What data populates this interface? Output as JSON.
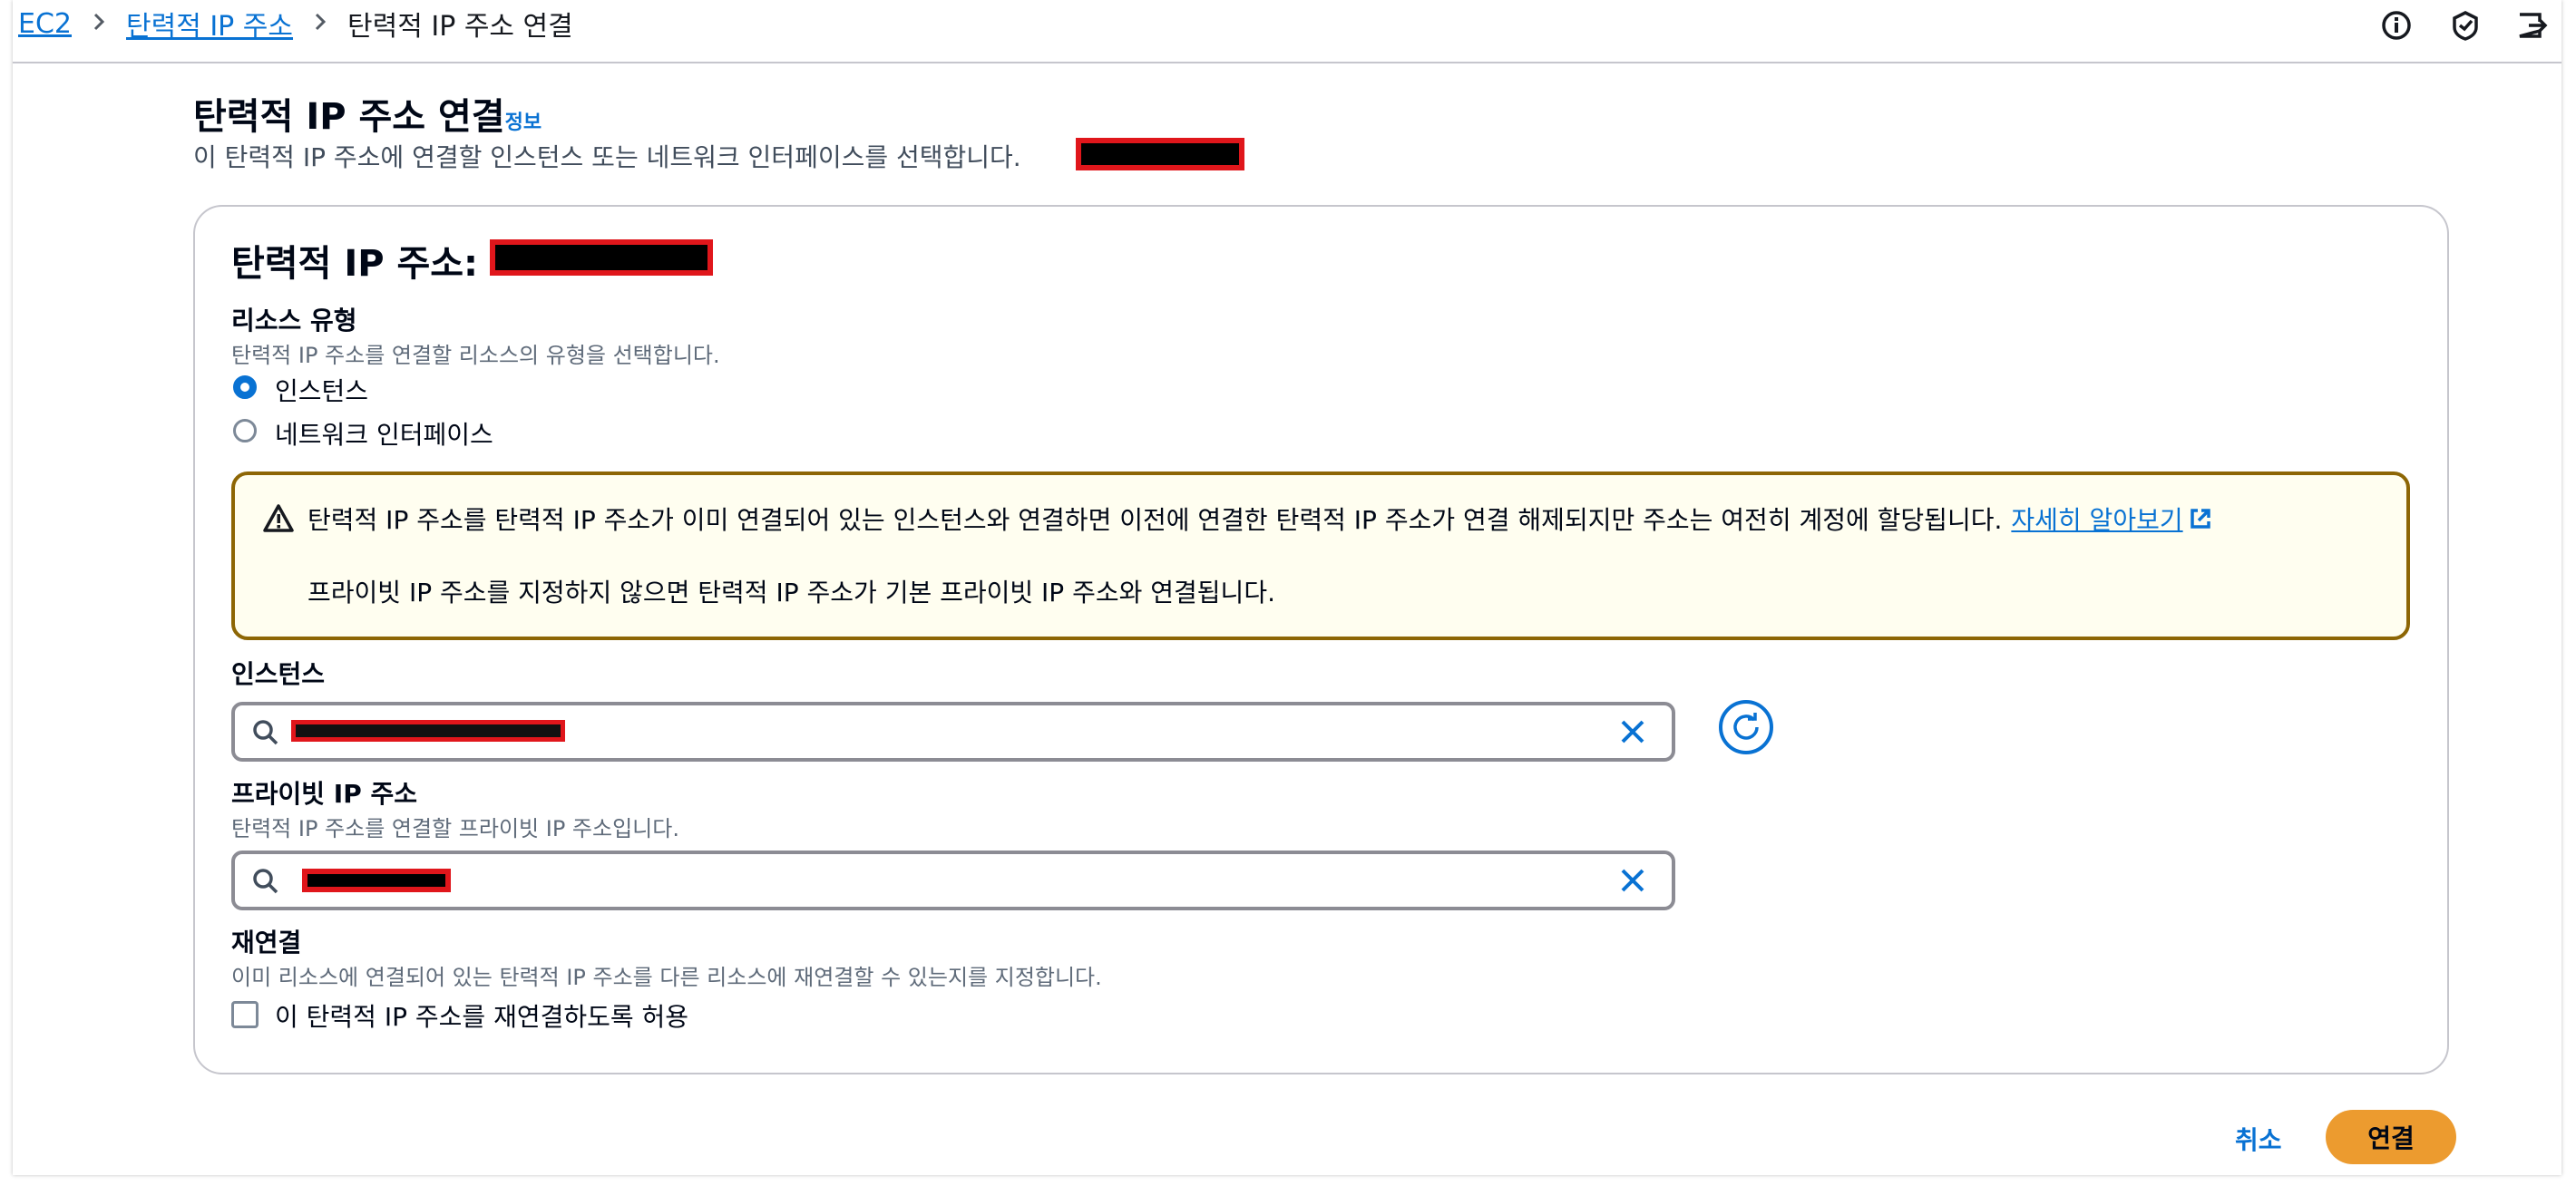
{
  "breadcrumb": {
    "items": [
      "EC2",
      "탄력적 IP 주소"
    ],
    "current": "탄력적 IP 주소 연결"
  },
  "top_icons": [
    "info-circle-icon",
    "notifications-icon",
    "exit-panel-icon"
  ],
  "header": {
    "title": "탄력적 IP 주소 연결",
    "info_link": "정보",
    "subtitle": "이 탄력적 IP 주소에 연결할 인스턴스 또는 네트워크 인터페이스를 선택합니다."
  },
  "card": {
    "eip_label": "탄력적 IP 주소:",
    "resource_type": {
      "label": "리소스 유형",
      "description": "탄력적 IP 주소를 연결할 리소스의 유형을 선택합니다.",
      "options": [
        "인스턴스",
        "네트워크 인터페이스"
      ],
      "selected": "인스턴스"
    },
    "alert": {
      "line1": "탄력적 IP 주소를 탄력적 IP 주소가 이미 연결되어 있는 인스턴스와 연결하면 이전에 연결한 탄력적 IP 주소가 연결 해제되지만 주소는 여전히 계정에 할당됩니다.",
      "learn_more": "자세히 알아보기",
      "line2": "프라이빗 IP 주소를 지정하지 않으면 탄력적 IP 주소가 기본 프라이빗 IP 주소와 연결됩니다."
    },
    "instance": {
      "label": "인스턴스"
    },
    "private_ip": {
      "label": "프라이빗 IP 주소",
      "description": "탄력적 IP 주소를 연결할 프라이빗 IP 주소입니다."
    },
    "reassociation": {
      "label": "재연결",
      "description": "이미 리소스에 연결되어 있는 탄력적 IP 주소를 다른 리소스에 재연결할 수 있는지를 지정합니다.",
      "checkbox_label": "이 탄력적 IP 주소를 재연결하도록 허용",
      "checked": false
    }
  },
  "footer": {
    "cancel": "취소",
    "submit": "연결"
  },
  "colors": {
    "accent": "#0972d3",
    "primary_button": "#ec9b2f",
    "warning_border": "#8d6605",
    "warning_bg": "#fffef0",
    "redaction_border": "#e0161b"
  }
}
